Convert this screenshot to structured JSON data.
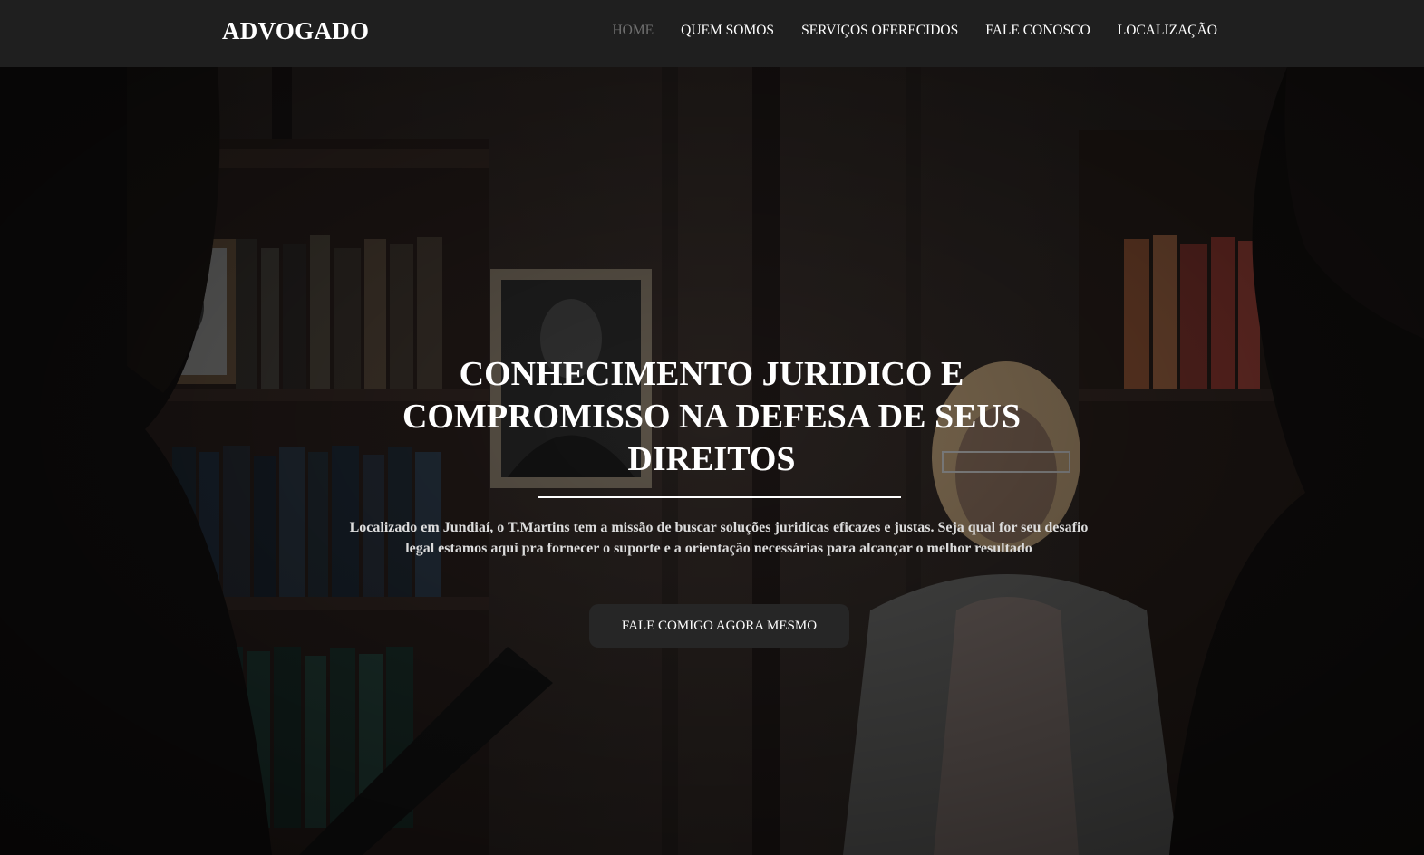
{
  "navbar": {
    "brand": "ADVOGADO",
    "items": [
      {
        "label": "HOME",
        "active": true
      },
      {
        "label": "QUEM SOMOS",
        "active": false
      },
      {
        "label": "SERVIÇOS OFERECIDOS",
        "active": false
      },
      {
        "label": "FALE CONOSCO",
        "active": false
      },
      {
        "label": "LOCALIZAÇÃO",
        "active": false
      }
    ]
  },
  "hero": {
    "title": "CONHECIMENTO JURIDICO E COMPROMISSO NA DEFESA DE SEUS DIREITOS",
    "text": "Localizado em Jundiaí, o T.Martins tem a missão de buscar soluções juridicas eficazes e justas. Seja qual for seu desafio legal estamos aqui pra fornecer o suporte e a orientação necessárias para alcançar o melhor resultado",
    "cta_label": "FALE COMIGO AGORA MESMO"
  },
  "colors": {
    "navbar_bg": "#1f1f1f",
    "nav_active": "#6f6f6f",
    "button_bg": "#262626",
    "text_light": "#ffffff"
  }
}
